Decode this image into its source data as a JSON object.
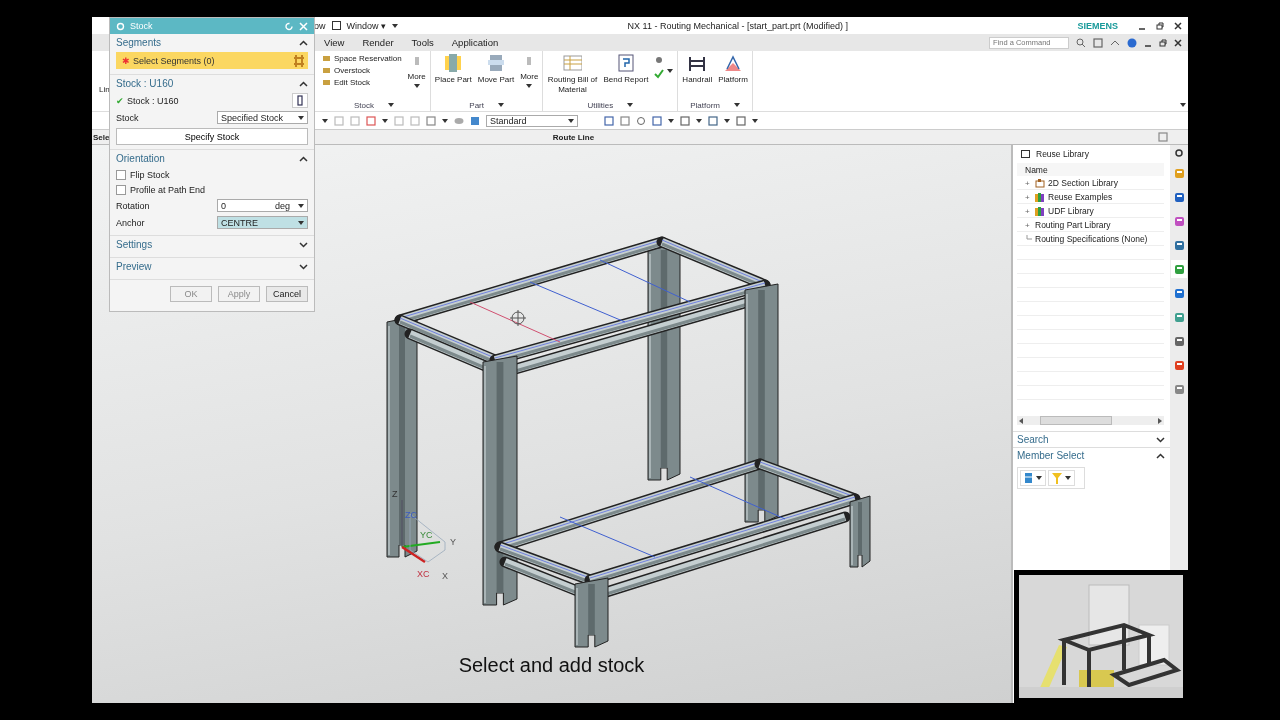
{
  "title_bar": {
    "quick_access": "ow",
    "window_menu": "Window ▾",
    "title": "NX 11 - Routing Mechanical - [start_part.prt (Modified) ]",
    "brand": "SIEMENS"
  },
  "menu_bar": {
    "items": [
      "View",
      "Render",
      "Tools",
      "Application"
    ],
    "search": {
      "placeholder": "Find a Command"
    }
  },
  "ribbon": {
    "left_cut_label": "Lin",
    "groups": [
      {
        "label": "Stock",
        "items": [
          {
            "kind": "small",
            "label": "Space Reservation"
          },
          {
            "kind": "small",
            "label": "Overstock"
          },
          {
            "kind": "small",
            "label": "Edit Stock"
          },
          {
            "kind": "more",
            "label": "More"
          }
        ]
      },
      {
        "label": "Part",
        "items": [
          {
            "kind": "large",
            "label": "Place Part"
          },
          {
            "kind": "large",
            "label": "Move Part"
          },
          {
            "kind": "more",
            "label": "More"
          }
        ]
      },
      {
        "label": "Utilities",
        "items": [
          {
            "kind": "large",
            "label": "Routing Bill of Material"
          },
          {
            "kind": "large",
            "label": "Bend Report"
          },
          {
            "kind": "icons"
          }
        ]
      },
      {
        "label": "Platform",
        "items": [
          {
            "kind": "large",
            "label": "Handrail"
          },
          {
            "kind": "large",
            "label": "Platform"
          }
        ]
      }
    ]
  },
  "toolbar": {
    "view_style": "Standard"
  },
  "route_header": {
    "left_cut_label": "Sele",
    "title": "Route Line"
  },
  "dialog": {
    "title": "Stock",
    "sections": [
      {
        "title": "Segments",
        "expanded": true,
        "rows": [
          {
            "kind": "selector",
            "mark": "✱",
            "label": "Select Segments (0)"
          }
        ]
      },
      {
        "title": "Stock : U160",
        "expanded": true,
        "rows": [
          {
            "kind": "status",
            "mark": "✔",
            "label": "Stock : U160"
          },
          {
            "kind": "dropdown",
            "label": "Stock",
            "value": "Specified Stock",
            "focused": false
          },
          {
            "kind": "button",
            "label": "Specify Stock"
          }
        ]
      },
      {
        "title": "Orientation",
        "expanded": true,
        "rows": [
          {
            "kind": "checkbox",
            "label": "Flip Stock",
            "checked": false
          },
          {
            "kind": "checkbox",
            "label": "Profile at Path End",
            "checked": false
          },
          {
            "kind": "number",
            "label": "Rotation",
            "value": "0",
            "unit": "deg"
          },
          {
            "kind": "dropdown",
            "label": "Anchor",
            "value": "CENTRE",
            "focused": true
          }
        ]
      },
      {
        "title": "Settings",
        "expanded": false
      },
      {
        "title": "Preview",
        "expanded": false
      }
    ],
    "buttons": [
      {
        "label": "OK",
        "disabled": true
      },
      {
        "label": "Apply",
        "disabled": true
      },
      {
        "label": "Cancel",
        "disabled": false
      }
    ]
  },
  "panel": {
    "title": "Reuse Library",
    "column": "Name",
    "tree": [
      {
        "label": "2D Section Library",
        "kind": "section",
        "expander": "+"
      },
      {
        "label": "Reuse Examples",
        "kind": "library",
        "expander": "+"
      },
      {
        "label": "UDF Library",
        "kind": "library",
        "expander": "+"
      },
      {
        "label": "Routing Part Library",
        "kind": "plain",
        "expander": "+"
      },
      {
        "label": "Routing Specifications (None)",
        "kind": "leaf"
      }
    ],
    "sections": [
      {
        "title": "Search",
        "expanded": false
      },
      {
        "title": "Member Select",
        "expanded": true
      }
    ]
  },
  "resource_bar": {
    "tabs": [
      {
        "selected": false
      },
      {
        "selected": false
      },
      {
        "selected": false
      },
      {
        "selected": false
      },
      {
        "selected": true
      },
      {
        "selected": false
      },
      {
        "selected": false
      },
      {
        "selected": false
      },
      {
        "selected": false
      },
      {
        "selected": false
      }
    ]
  },
  "viewport": {
    "caption": "Select and add stock",
    "triad": {
      "z": "Z",
      "zc": "ZC",
      "yc": "YC",
      "y": "Y",
      "xc": "XC",
      "x": "X"
    }
  }
}
